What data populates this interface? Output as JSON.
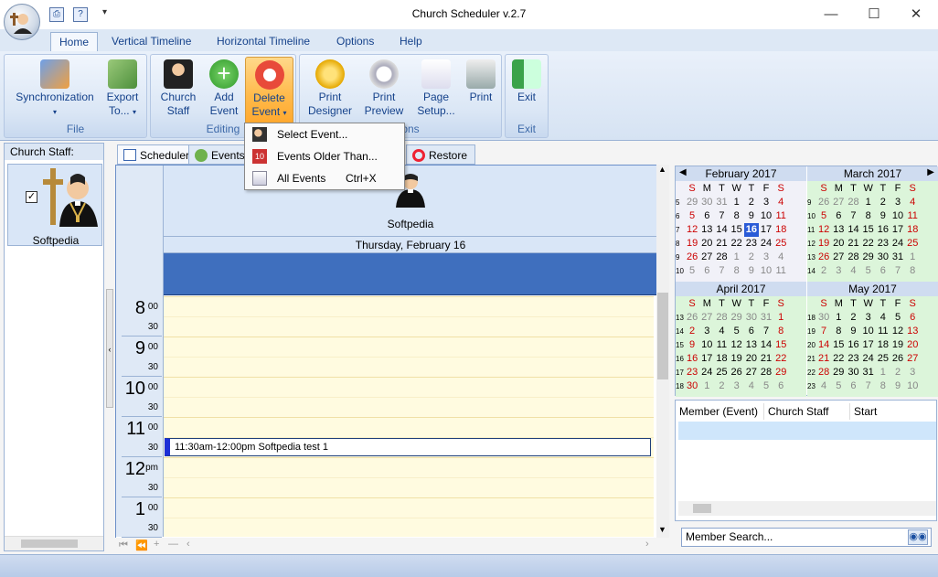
{
  "window": {
    "title": "Church Scheduler v.2.7"
  },
  "tabs": [
    "Home",
    "Vertical Timeline",
    "Horizontal Timeline",
    "Options",
    "Help"
  ],
  "ribbon": {
    "sync": {
      "label1": "Synchronization",
      "group": "File"
    },
    "export": {
      "label1": "Export",
      "label2": "To..."
    },
    "church_staff": {
      "label1": "Church",
      "label2": "Staff"
    },
    "add_event": {
      "label1": "Add",
      "label2": "Event"
    },
    "delete_event": {
      "label1": "Delete",
      "label2": "Event"
    },
    "editing_group": "Editing",
    "print_designer": {
      "label1": "Print",
      "label2": "Designer"
    },
    "print_preview": {
      "label1": "Print",
      "label2": "Preview"
    },
    "page_setup": {
      "label1": "Page",
      "label2": "Setup..."
    },
    "print": {
      "label1": "Print"
    },
    "options_group": "Options",
    "exit": {
      "label1": "Exit",
      "group": "Exit"
    }
  },
  "delete_menu": {
    "items": [
      {
        "label": "Select Event...",
        "shortcut": ""
      },
      {
        "label": "Events Older Than...",
        "shortcut": ""
      },
      {
        "label": "All Events",
        "shortcut": "Ctrl+X"
      }
    ]
  },
  "left_panel": {
    "header": "Church Staff:",
    "staff_name": "Softpedia"
  },
  "view_tabs": {
    "scheduler": "Scheduler",
    "events": "Events",
    "restore": "Restore"
  },
  "scheduler": {
    "resource_name": "Softpedia",
    "date": "Thursday, February 16",
    "hours": [
      {
        "h": "8",
        "m": "00",
        "half": "30"
      },
      {
        "h": "9",
        "m": "00",
        "half": "30"
      },
      {
        "h": "10",
        "m": "00",
        "half": "30"
      },
      {
        "h": "11",
        "m": "00",
        "half": "30"
      },
      {
        "h": "12",
        "m": "pm",
        "half": "30"
      },
      {
        "h": "1",
        "m": "00",
        "half": "30"
      }
    ],
    "event_text": "11:30am-12:00pm Softpedia test 1"
  },
  "calendars": {
    "feb": {
      "title": "February 2017"
    },
    "mar": {
      "title": "March 2017"
    },
    "apr": {
      "title": "April 2017"
    },
    "may": {
      "title": "May 2017"
    },
    "weekdays": [
      "S",
      "M",
      "T",
      "W",
      "T",
      "F",
      "S"
    ]
  },
  "members": {
    "columns": [
      "Member (Event)",
      "Church Staff",
      "Start"
    ],
    "search_placeholder": "Member Search..."
  },
  "colors": {
    "accent": "#3f6fbe",
    "event_bar": "#1c2fd6",
    "today": "#2a5bd7"
  }
}
